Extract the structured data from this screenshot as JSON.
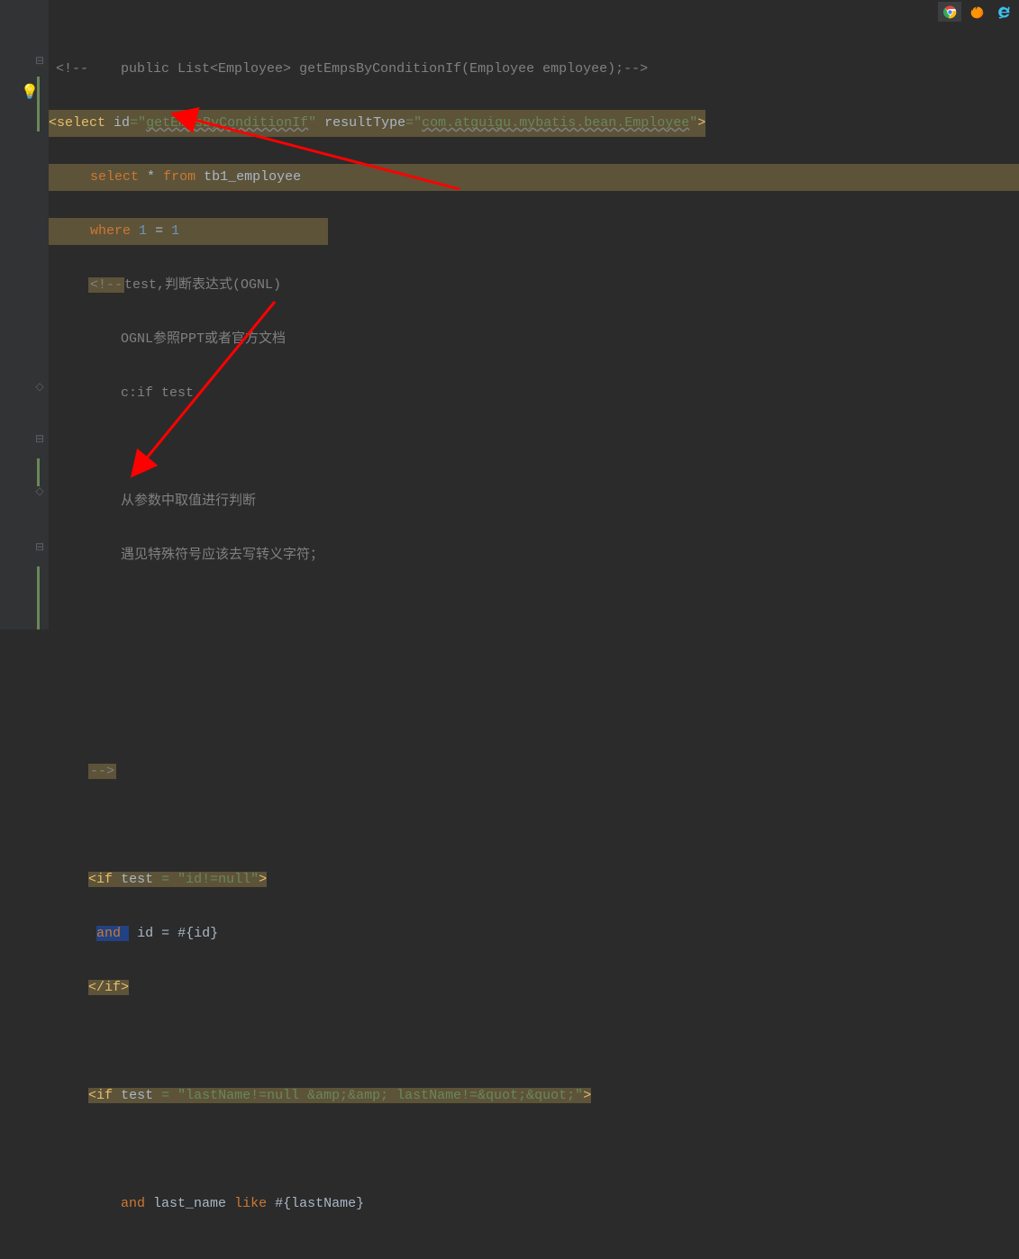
{
  "code": {
    "comment_sig_prefix": "<!--",
    "comment_sig": "public List<Employee> getEmpsByConditionIf(Employee employee);-->",
    "select_open_1": "<",
    "select_tag": "select",
    "id_attr": "id",
    "id_val": "getEmpsByConditionIf",
    "result_attr": "resultType",
    "result_val": "com.atguigu.mybatis.bean.Employee",
    "close": ">",
    "sql_select": "select * from tb1_employee",
    "sql_select_kw": "select",
    "sql_star": "*",
    "sql_from": "from",
    "sql_table": "tb1_employee",
    "sql_where": "where",
    "sql_num1": "1",
    "sql_eq": "=",
    "sql_num2": "1",
    "c_open": "<!--",
    "c1": "test,判断表达式(OGNL)",
    "c2": "OGNL参照PPT或者官方文档",
    "c3": "c:if test",
    "c4": "从参数中取值进行判断",
    "c5": "遇见特殊符号应该去写转义字符；",
    "c_close": "-->",
    "if_tag": "if",
    "test_attr": "test",
    "test1_val": "id!=null",
    "and_kw": "and",
    "id_expr": "id = #{id}",
    "if_close_open": "</",
    "test2_val": "lastName!=null &amp;&amp; lastName!=&quot;&quot;",
    "lastname_sql": "and last_name like #{lastName}",
    "lastname_and": "and",
    "lastname_col": "last_name",
    "lastname_like": "like",
    "lastname_param": "#{lastName}"
  },
  "icons": {
    "chrome": "chrome",
    "firefox": "firefox",
    "ie": "internet-explorer"
  }
}
